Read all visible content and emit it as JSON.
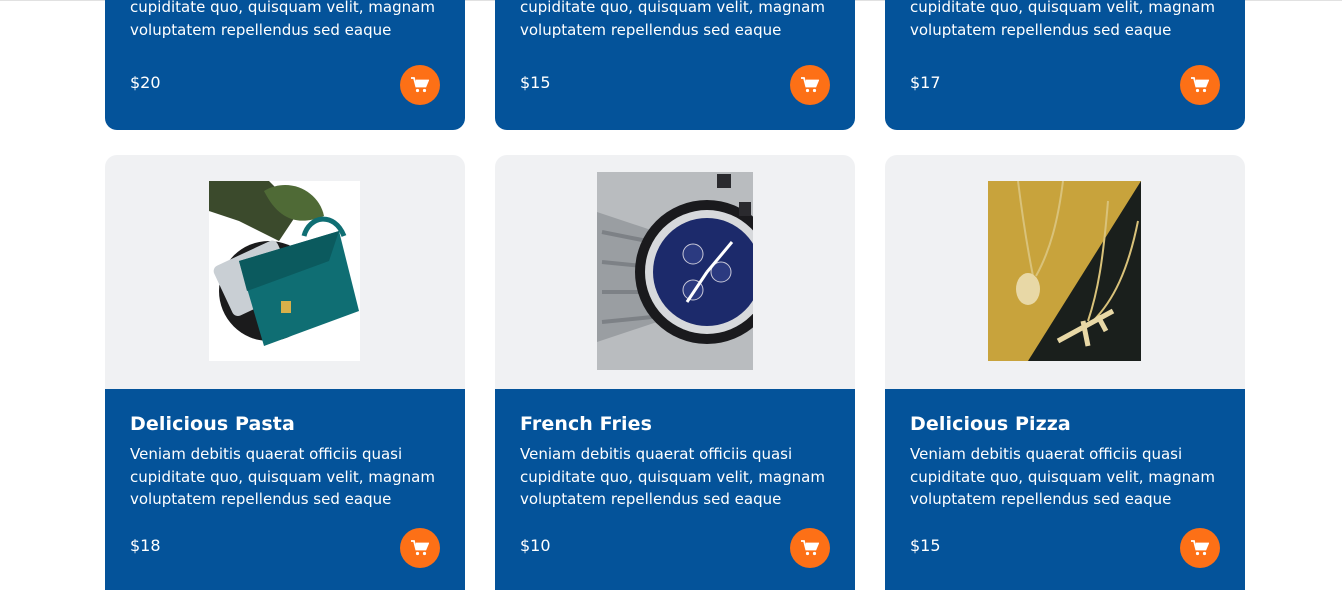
{
  "products_top": [
    {
      "desc_line1": "cupiditate quo, quisquam velit, magnam",
      "desc_line2": "voluptatem repellendus sed eaque",
      "price": "$20"
    },
    {
      "desc_line1": "cupiditate quo, quisquam velit, magnam",
      "desc_line2": "voluptatem repellendus sed eaque",
      "price": "$15"
    },
    {
      "desc_line1": "cupiditate quo, quisquam velit, magnam",
      "desc_line2": "voluptatem repellendus sed eaque",
      "price": "$17"
    }
  ],
  "products_bottom": [
    {
      "title": "Delicious Pasta",
      "desc": "Veniam debitis quaerat officiis quasi cupiditate quo, quisquam velit, magnam voluptatem repellendus sed eaque",
      "price": "$18",
      "image": "handbag-photo"
    },
    {
      "title": "French Fries",
      "desc": "Veniam debitis quaerat officiis quasi cupiditate quo, quisquam velit, magnam voluptatem repellendus sed eaque",
      "price": "$10",
      "image": "wristwatch-photo"
    },
    {
      "title": "Delicious Pizza",
      "desc": "Veniam debitis quaerat officiis quasi cupiditate quo, quisquam velit, magnam voluptatem repellendus sed eaque",
      "price": "$15",
      "image": "gold-chain-photo"
    }
  ],
  "icons": {
    "cart": "cart-icon"
  },
  "colors": {
    "card_blue": "#04539a",
    "image_bg": "#f0f1f3",
    "cart_orange": "#fd7016"
  }
}
